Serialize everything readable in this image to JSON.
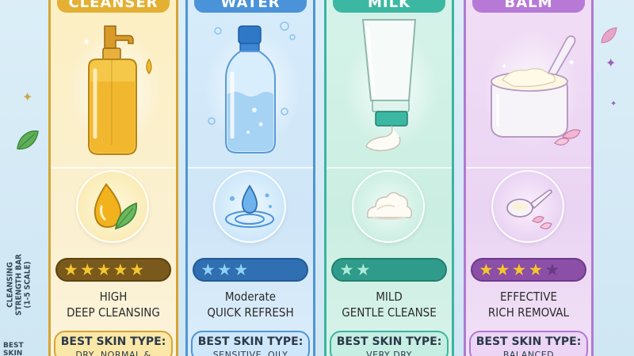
{
  "side_labels": {
    "strength_line1": "CLEANSING",
    "strength_line2": "STRENGTH BAR",
    "strength_line3": "(1-5 SCALE)",
    "skin_line1": "BEST",
    "skin_line2": "SKIN TYPE"
  },
  "panels": [
    {
      "banner": "CLEANSER",
      "product_icon": "oil-pump-bottle-icon",
      "feature_icon": "oil-drop-leaf-icon",
      "rating": 5,
      "max_rating": 5,
      "strength": "HIGH",
      "description": "DEEP CLEANSING",
      "skin_label": "BEST SKIN TYPE:",
      "skin_value": "DRY, NORMAL &",
      "accent": "#e3b033"
    },
    {
      "banner": "WATER",
      "product_icon": "micellar-water-bottle-icon",
      "feature_icon": "water-drop-ripple-icon",
      "rating": 3,
      "max_rating": 3,
      "strength": "Moderate",
      "description": "QUICK REFRESH",
      "skin_label": "BEST SKIN TYPE:",
      "skin_value": "SENSITIVE, OILY",
      "accent": "#4a93d8"
    },
    {
      "banner": "MILK",
      "product_icon": "milk-tube-icon",
      "feature_icon": "cream-swirl-icon",
      "rating": 2,
      "max_rating": 2,
      "strength": "MILD",
      "description": "GENTLE CLEANSE",
      "skin_label": "BEST SKIN TYPE:",
      "skin_value": "VERY DRY",
      "accent": "#3cb8a2"
    },
    {
      "banner": "BALM",
      "product_icon": "balm-jar-icon",
      "feature_icon": "spoon-petals-icon",
      "rating": 4,
      "max_rating": 5,
      "strength": "EFFECTIVE",
      "description": "RICH REMOVAL",
      "skin_label": "BEST SKIN TYPE:",
      "skin_value": "BALANCED",
      "accent": "#b67ad6"
    }
  ]
}
